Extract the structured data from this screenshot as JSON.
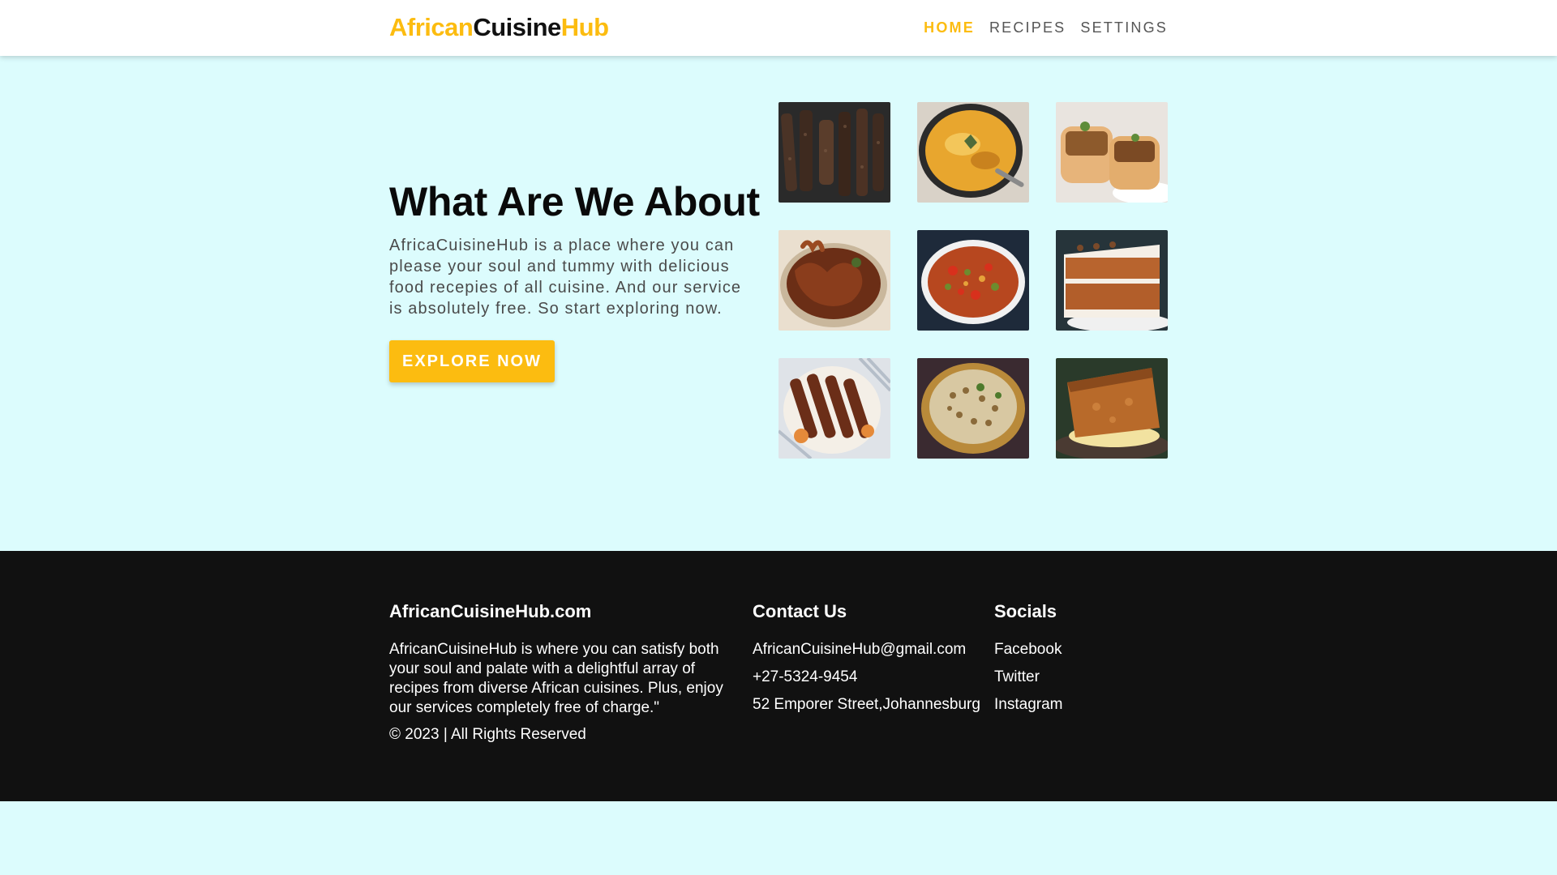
{
  "brand": {
    "part1": "African",
    "part2": "Cuisine",
    "part3": "Hub",
    "accent_color": "#fcbc10"
  },
  "nav": {
    "items": [
      {
        "label": "HOME",
        "active": true
      },
      {
        "label": "RECIPES",
        "active": false
      },
      {
        "label": "SETTINGS",
        "active": false
      }
    ]
  },
  "hero": {
    "title": "What Are We About",
    "text": "AfricaCuisineHub is a place where you can please your soul and tummy with delicious food recepies of all cuisine. And our service is absolutely free. So start exploring now.",
    "button_label": "EXPLORE NOW"
  },
  "gallery": {
    "images": [
      {
        "icon": "biltong-image"
      },
      {
        "icon": "bobotie-image"
      },
      {
        "icon": "bunny-chow-image"
      },
      {
        "icon": "chicken-feet-image"
      },
      {
        "icon": "chakalaka-image"
      },
      {
        "icon": "carrot-cake-image"
      },
      {
        "icon": "skewers-image"
      },
      {
        "icon": "samp-beans-image"
      },
      {
        "icon": "malva-pudding-image"
      }
    ]
  },
  "footer": {
    "about": {
      "heading": "AfricanCuisineHub.com",
      "text": "AfricanCuisineHub is where you can satisfy both your soul and palate with a delightful array of recipes from diverse African cuisines. Plus, enjoy our services completely free of charge.\"",
      "copyright": "© 2023 | All Rights Reserved"
    },
    "contact": {
      "heading": "Contact Us",
      "email": "AfricanCuisineHub@gmail.com",
      "phone": "+27-5324-9454",
      "address": "52 Emporer Street,Johannesburg"
    },
    "socials": {
      "heading": "Socials",
      "links": [
        "Facebook",
        "Twitter",
        "Instagram"
      ]
    }
  }
}
